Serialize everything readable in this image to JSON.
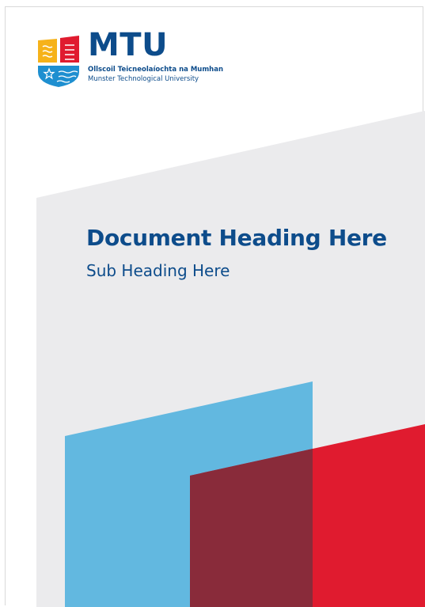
{
  "logo": {
    "wordmark": "MTU",
    "irish_name": "Ollscoil Teicneolaíochta na Mumhan",
    "english_name": "Munster Technological University"
  },
  "cover": {
    "heading": "Document Heading Here",
    "subheading": "Sub Heading Here"
  },
  "colors": {
    "brand_blue": "#0d4c8b",
    "light_grey": "#ebebed",
    "sky_blue": "#62b8e0",
    "red": "#e01b2f",
    "overlap_maroon": "#892b3a",
    "shield_yellow": "#f6b21a",
    "shield_red": "#e01b2f",
    "shield_blue": "#1e8fd0"
  }
}
